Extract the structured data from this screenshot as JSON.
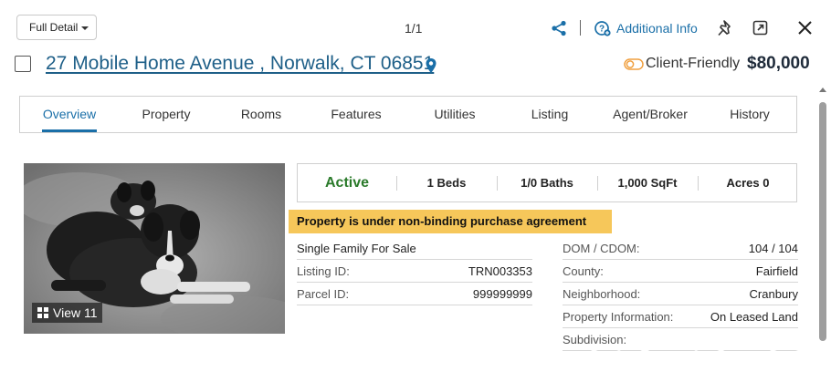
{
  "toolbar": {
    "view_mode": "Full Detail",
    "counter": "1/1",
    "additional_info": "Additional Info"
  },
  "listing": {
    "address": "27 Mobile Home Avenue , Norwalk, CT 06851",
    "client_friendly": "Client-Friendly",
    "price": "$80,000"
  },
  "tabs": [
    {
      "label": "Overview",
      "active": true
    },
    {
      "label": "Property"
    },
    {
      "label": "Rooms"
    },
    {
      "label": "Features"
    },
    {
      "label": "Utilities"
    },
    {
      "label": "Listing"
    },
    {
      "label": "Agent/Broker"
    },
    {
      "label": "History"
    }
  ],
  "photo": {
    "view_label": "View 11"
  },
  "stats": {
    "status": "Active",
    "beds": "1 Beds",
    "baths": "1/0 Baths",
    "sqft": "1,000 SqFt",
    "acres": "Acres 0"
  },
  "banner": "Property is under non-binding purchase agreement",
  "left_details": {
    "type": "Single Family For Sale",
    "rows": [
      {
        "label": "Listing ID:",
        "value": "TRN003353"
      },
      {
        "label": "Parcel ID:",
        "value": "999999999"
      }
    ]
  },
  "right_details": [
    {
      "label": "DOM / CDOM:",
      "value": "104 / 104"
    },
    {
      "label": "County:",
      "value": "Fairfield"
    },
    {
      "label": "Neighborhood:",
      "value": "Cranbury"
    },
    {
      "label": "Property Information:",
      "value": "On Leased Land"
    },
    {
      "label": "Subdivision:",
      "value": ""
    }
  ],
  "colors": {
    "accent": "#1a6fa8",
    "status_active": "#2a7a2a",
    "banner": "#f6c75a",
    "client_friendly_icon": "#f0a040"
  },
  "icons": [
    "chevron-down-icon",
    "share-icon",
    "info-icon",
    "pin-icon",
    "external-link-icon",
    "close-icon",
    "map-pin-icon",
    "client-friendly-icon",
    "grid-icon"
  ]
}
